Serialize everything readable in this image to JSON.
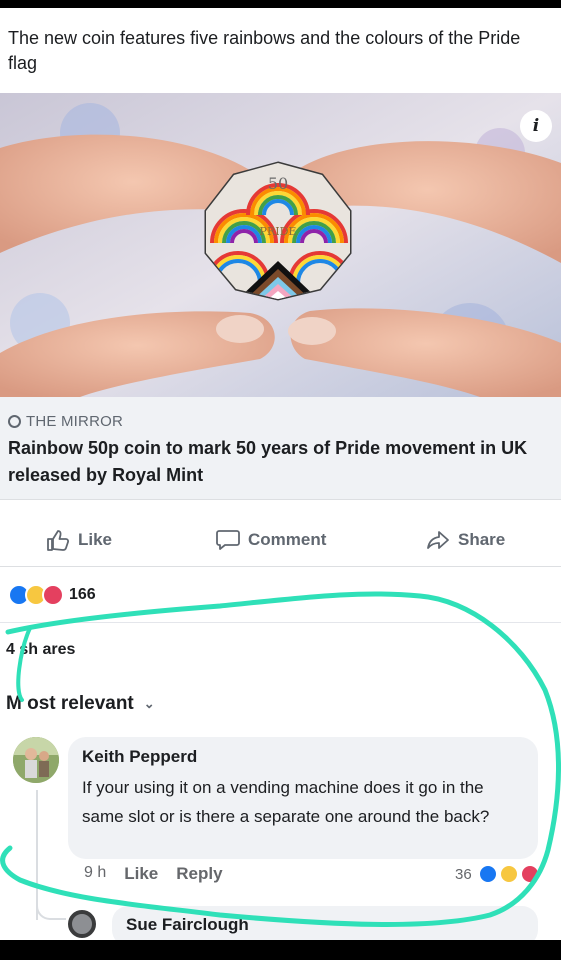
{
  "post": {
    "caption": "The new coin features five rainbows and the colours of the Pride flag"
  },
  "link": {
    "info_glyph": "i",
    "source": "THE MIRROR",
    "title": "Rainbow 50p coin to mark 50 years of Pride movement in UK released by Royal Mint",
    "coin_text": "PRIDE",
    "coin_value": "50"
  },
  "actions": {
    "like": "Like",
    "comment": "Comment",
    "share": "Share"
  },
  "stats": {
    "reaction_count": "166",
    "shares": "4 sh ares"
  },
  "comments": {
    "sort_label": "M ost relevant",
    "items": [
      {
        "author": "Keith Pepperd",
        "text": "If your using it on a vending machine does it go in the same slot or is there a separate one around the back?",
        "time": "9 h",
        "like_label": "Like",
        "reply_label": "Reply",
        "reaction_count": "36"
      }
    ],
    "reply_author": "Sue Fairclough"
  },
  "colors": {
    "accent": "#1877f2",
    "highlight_ink": "#2fe0b8",
    "text_secondary": "#606770"
  }
}
